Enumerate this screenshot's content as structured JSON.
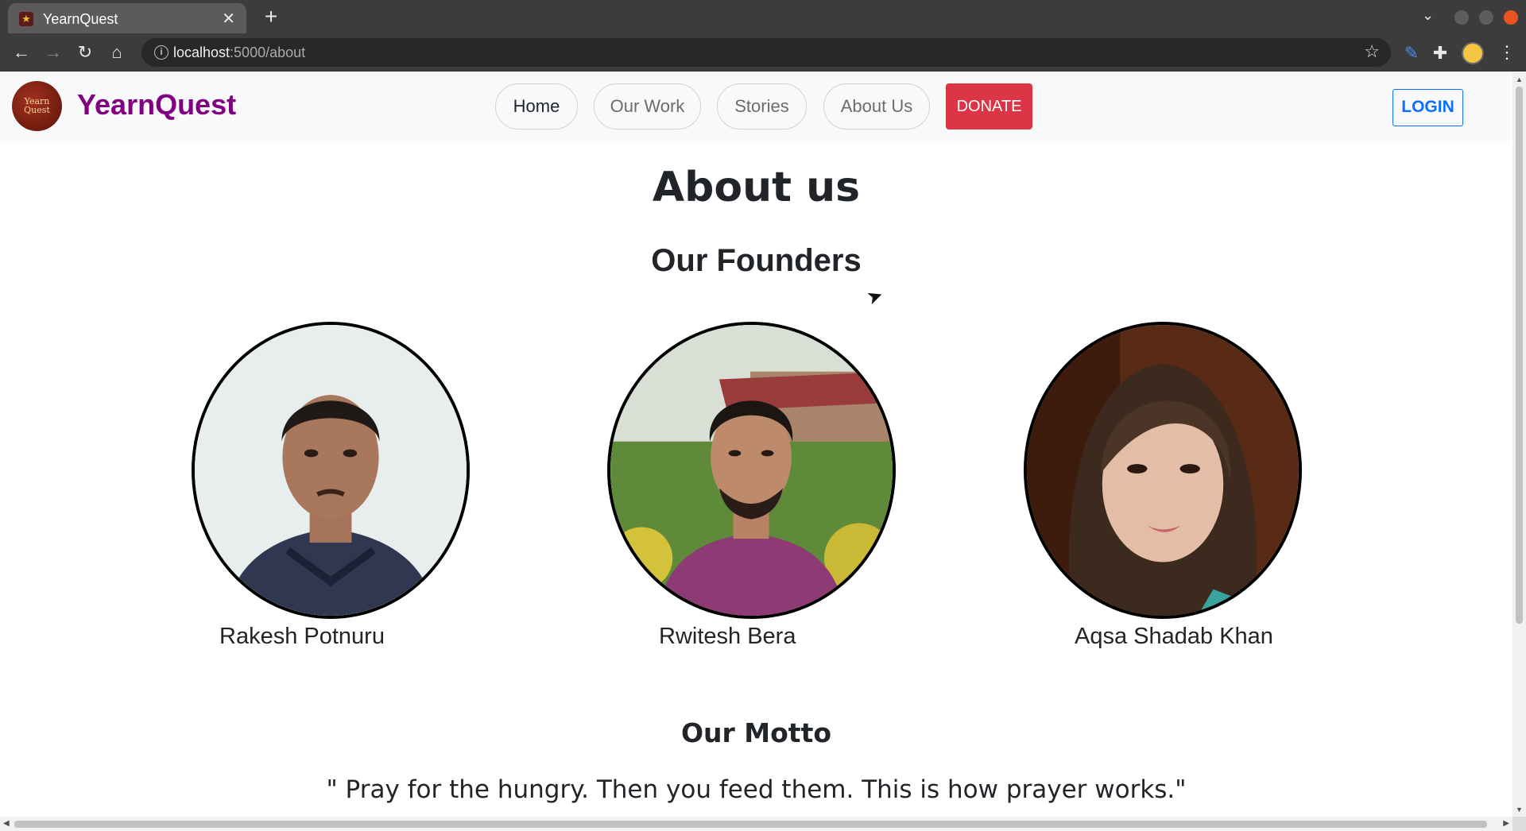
{
  "browser": {
    "tab_title": "YearnQuest",
    "url_host": "localhost",
    "url_path": ":5000/about"
  },
  "site": {
    "logo_text": "Yearn Quest",
    "brand": "YearnQuest",
    "nav": [
      {
        "label": "Home",
        "active": true
      },
      {
        "label": "Our Work",
        "active": false
      },
      {
        "label": "Stories",
        "active": false
      },
      {
        "label": "About Us",
        "active": false
      }
    ],
    "donate_label": "DONATE",
    "login_label": "LOGIN"
  },
  "page": {
    "title": "About us",
    "founders_heading": "Our Founders",
    "founders": [
      {
        "name": "Rakesh Potnuru"
      },
      {
        "name": "Rwitesh Bera"
      },
      {
        "name": "Aqsa Shadab Khan"
      }
    ],
    "motto_heading": "Our Motto",
    "motto": "\" Pray for the hungry. Then you feed them. This is how prayer works.\""
  },
  "colors": {
    "brand": "#800080",
    "donate": "#dc3545",
    "login": "#0d6efd"
  }
}
